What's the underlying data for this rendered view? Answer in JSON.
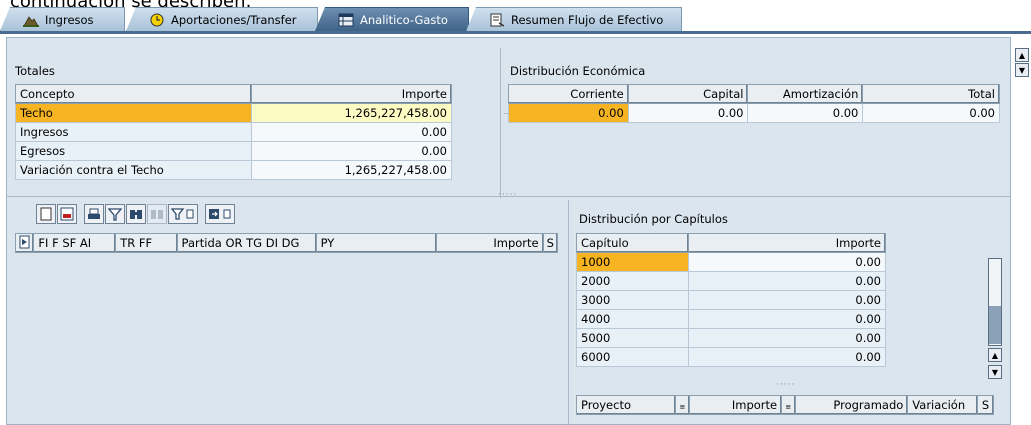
{
  "clipped_header_text": "continuación se describen:",
  "tabs": [
    {
      "label": "Ingresos",
      "icon": "mountain-icon"
    },
    {
      "label": "Aportaciones/Transfer",
      "icon": "clock-icon"
    },
    {
      "label": "Analitico-Gasto",
      "icon": "grid-icon",
      "active": true
    },
    {
      "label": "Resumen Flujo de Efectivo",
      "icon": "document-icon"
    }
  ],
  "totales": {
    "title": "Totales",
    "col_concepto": "Concepto",
    "col_importe": "Importe",
    "rows": [
      {
        "concepto": "Techo",
        "importe": "1,265,227,458.00"
      },
      {
        "concepto": "Ingresos",
        "importe": "0.00"
      },
      {
        "concepto": "Egresos",
        "importe": "0.00"
      },
      {
        "concepto": "Variación contra el Techo",
        "importe": "1,265,227,458.00"
      }
    ]
  },
  "distribucion_economica": {
    "title": "Distribución Económica",
    "headers": [
      "Corriente",
      "Capital",
      "Amortización",
      "Total"
    ],
    "values": [
      "0.00",
      "0.00",
      "0.00",
      "0.00"
    ]
  },
  "detail_grid": {
    "headers": [
      "FI F SF AI",
      "TR FF",
      "Partida OR TG DI DG",
      "PY",
      "Importe",
      "S"
    ]
  },
  "capitulos": {
    "title": "Distribución por Capítulos",
    "col_capitulo": "Capítulo",
    "col_importe": "Importe",
    "rows": [
      {
        "capitulo": "1000",
        "importe": "0.00"
      },
      {
        "capitulo": "2000",
        "importe": "0.00"
      },
      {
        "capitulo": "3000",
        "importe": "0.00"
      },
      {
        "capitulo": "4000",
        "importe": "0.00"
      },
      {
        "capitulo": "5000",
        "importe": "0.00"
      },
      {
        "capitulo": "6000",
        "importe": "0.00"
      }
    ]
  },
  "proyectos": {
    "headers": [
      "Proyecto",
      "Importe",
      "Programado",
      "Variación",
      "S"
    ]
  },
  "colors": {
    "selection": "#f6b422",
    "highlight": "#fdfbc4",
    "active_tab": "#3f6288",
    "panel_bg": "#dbe5ee"
  }
}
